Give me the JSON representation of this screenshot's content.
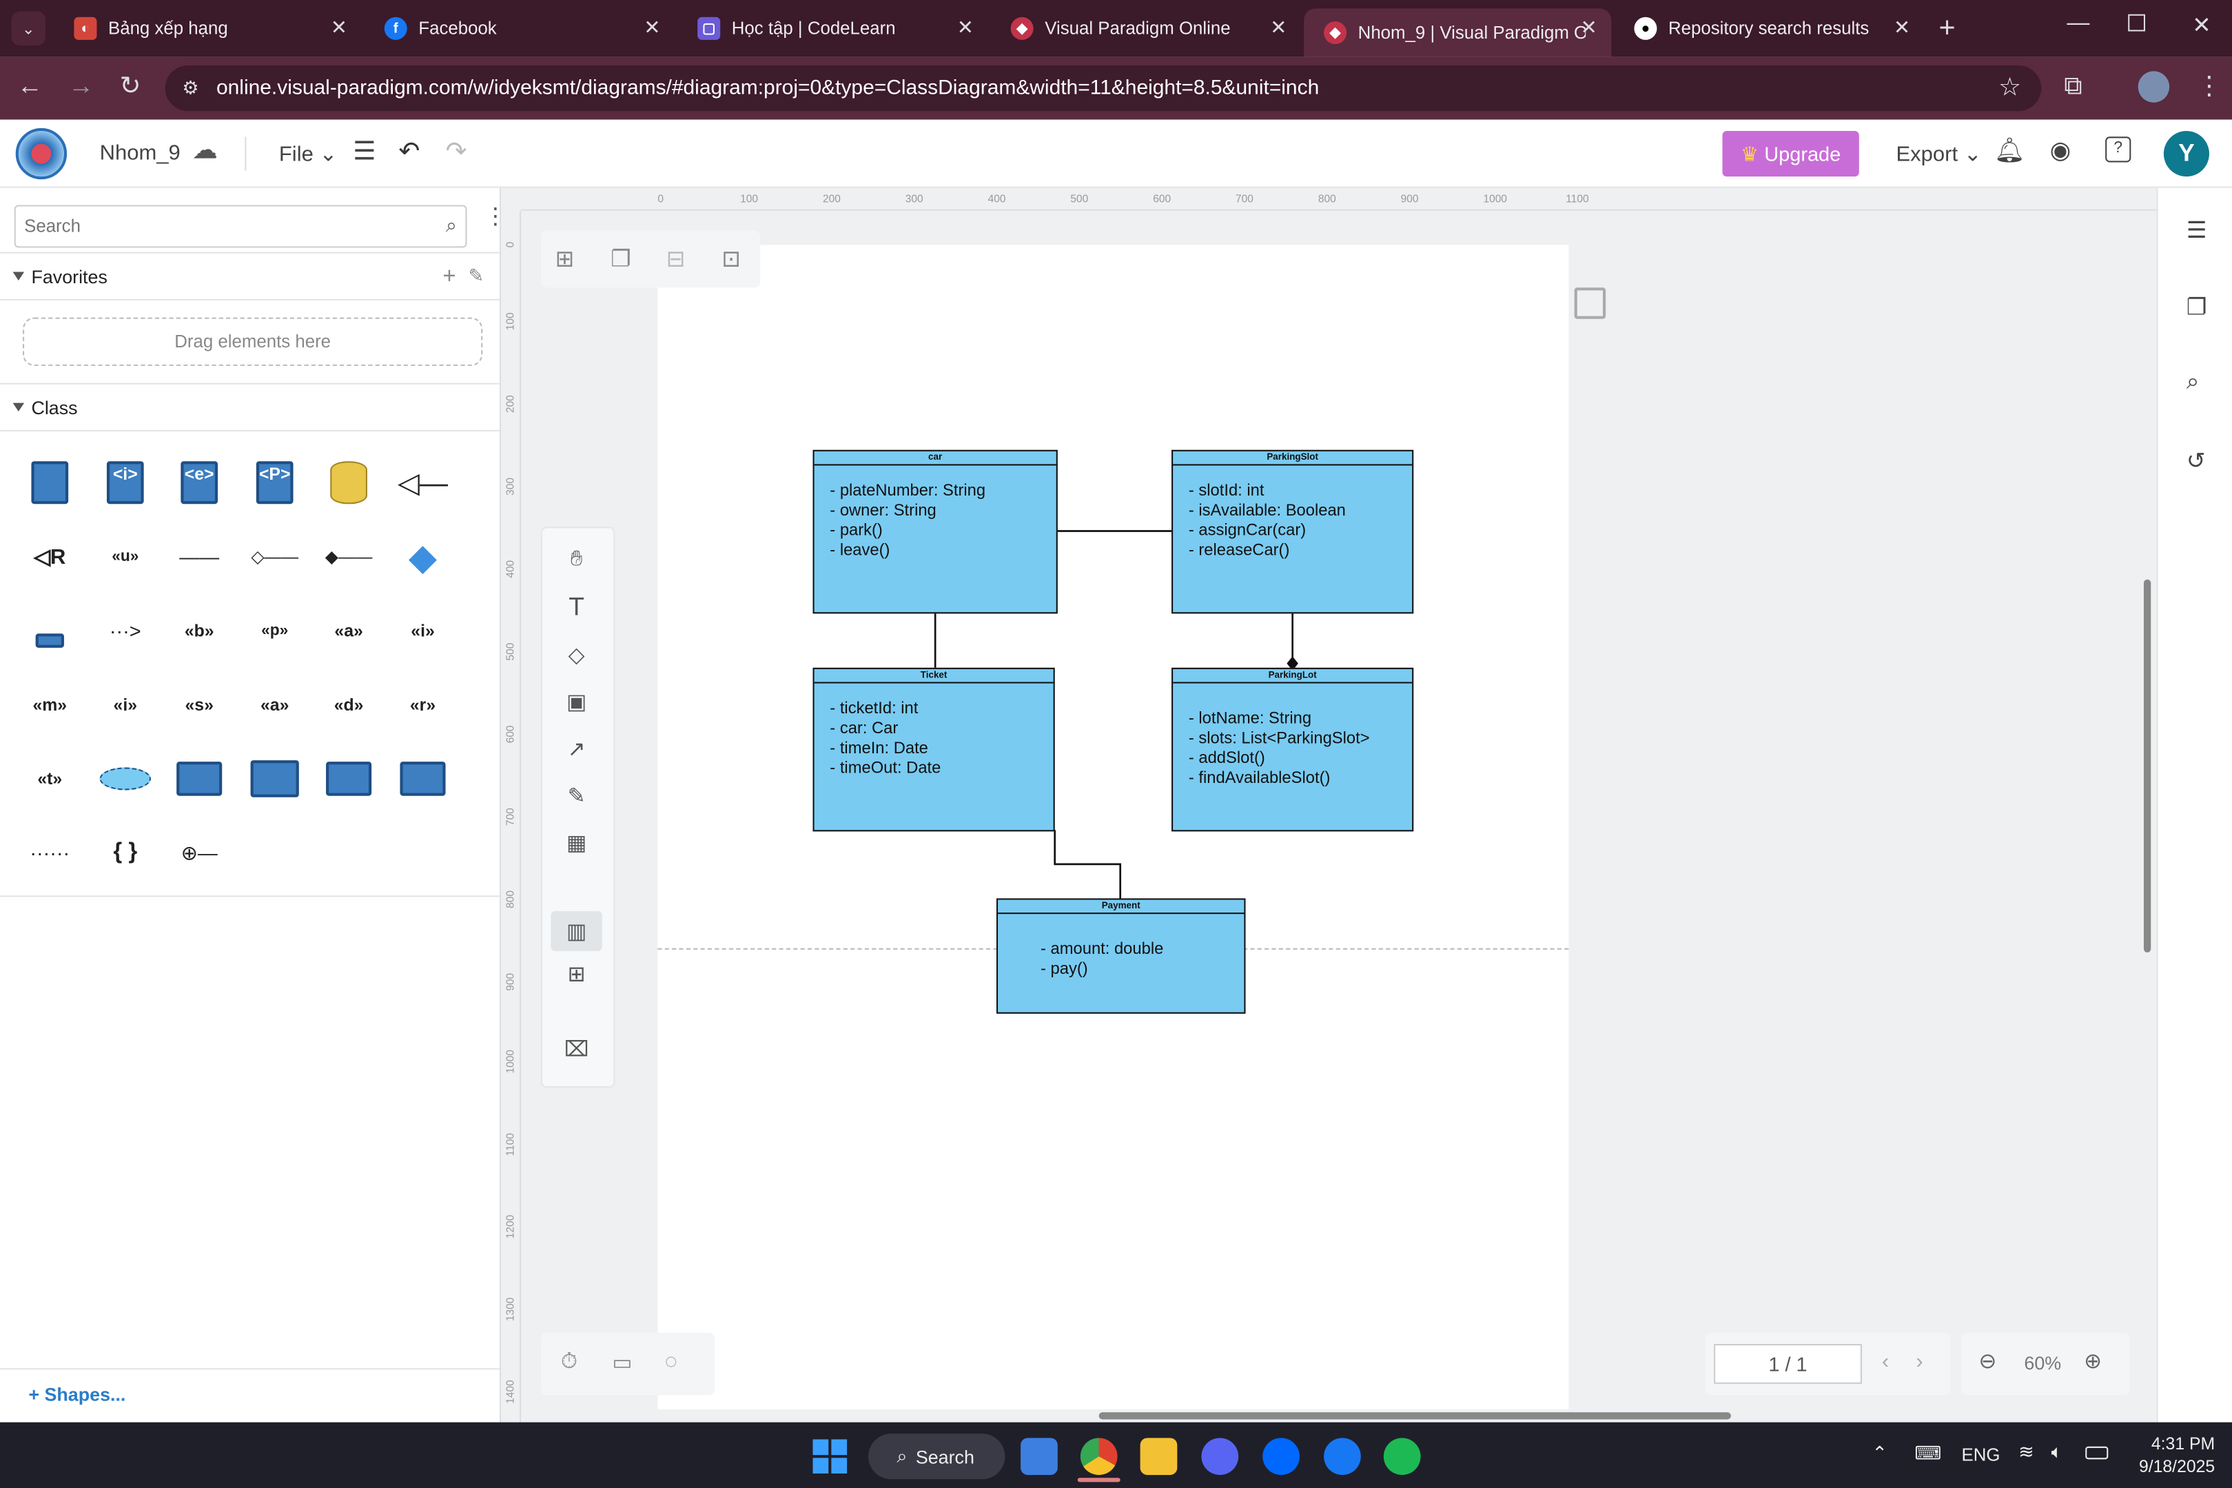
{
  "browser": {
    "tabs": [
      {
        "title": "Bảng xếp hạng",
        "icon": "codelearn-icon",
        "active": false
      },
      {
        "title": "Facebook",
        "icon": "facebook-icon",
        "active": false
      },
      {
        "title": "Học tập | CodeLearn",
        "icon": "codelearn-icon",
        "active": false
      },
      {
        "title": "Visual Paradigm Online",
        "icon": "visual-paradigm-icon",
        "active": false
      },
      {
        "title": "Nhom_9 | Visual Paradigm Or",
        "icon": "visual-paradigm-icon",
        "active": true
      },
      {
        "title": "Repository search results",
        "icon": "github-icon",
        "active": false
      }
    ],
    "url": "online.visual-paradigm.com/w/idyeksmt/diagrams/#diagram:proj=0&type=ClassDiagram&width=11&height=8.5&unit=inch"
  },
  "app": {
    "project_name": "Nhom_9",
    "file_menu": "File",
    "upgrade_label": "Upgrade",
    "export_label": "Export",
    "avatar_letter": "Y"
  },
  "left_panel": {
    "search_placeholder": "Search",
    "favorites_label": "Favorites",
    "drag_hint": "Drag elements here",
    "class_label": "Class",
    "shapes_label": "Shapes..."
  },
  "ruler": {
    "top": [
      "0",
      "100",
      "200",
      "300",
      "400",
      "500",
      "600",
      "700",
      "800",
      "900",
      "1000",
      "1100"
    ],
    "left": [
      "0",
      "100",
      "200",
      "300",
      "400",
      "500",
      "600",
      "700",
      "800",
      "900",
      "1000",
      "1100",
      "1200",
      "1300",
      "1400"
    ]
  },
  "diagram": {
    "classes": [
      {
        "name": "car",
        "attrs": [
          "- plateNumber: String",
          "- owner: String",
          "- park()",
          "- leave()"
        ]
      },
      {
        "name": "ParkingSlot",
        "attrs": [
          "- slotId: int",
          "- isAvailable: Boolean",
          "- assignCar(car)",
          "- releaseCar()"
        ]
      },
      {
        "name": "Ticket",
        "attrs": [
          "- ticketId: int",
          "- car: Car",
          "- timeIn: Date",
          "- timeOut: Date"
        ]
      },
      {
        "name": "ParkingLot",
        "attrs": [
          "- lotName: String",
          "- slots: List<ParkingSlot>",
          "- addSlot()",
          "- findAvailableSlot()"
        ]
      },
      {
        "name": "Payment",
        "attrs": [
          "- amount: double",
          "- pay()"
        ]
      }
    ]
  },
  "bottom_controls": {
    "page_indicator": "1 / 1",
    "zoom": "60%"
  },
  "taskbar": {
    "search_label": "Search",
    "language": "ENG",
    "time": "4:31 PM",
    "date": "9/18/2025"
  },
  "colors": {
    "class_fill": "#79cbf2",
    "upgrade_bg": "#c86dd7",
    "browser_frame": "#5a2a3f"
  }
}
